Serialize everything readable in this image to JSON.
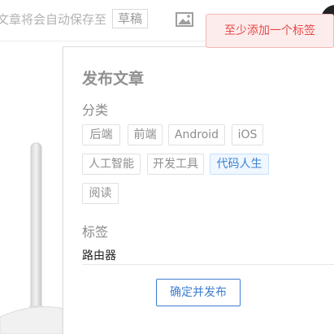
{
  "header": {
    "autosave_text": "文章将会自动保存至",
    "draft_label": "草稿"
  },
  "toast": {
    "message": "至少添加一个标签"
  },
  "publish_panel": {
    "title": "发布文章",
    "category_label": "分类",
    "categories": [
      {
        "label": "后端",
        "selected": false
      },
      {
        "label": "前端",
        "selected": false
      },
      {
        "label": "Android",
        "selected": false
      },
      {
        "label": "iOS",
        "selected": false
      },
      {
        "label": "人工智能",
        "selected": false
      },
      {
        "label": "开发工具",
        "selected": false
      },
      {
        "label": "代码人生",
        "selected": true
      },
      {
        "label": "阅读",
        "selected": false
      }
    ],
    "tags_label": "标签",
    "tag_value": "路由器",
    "publish_button": "确定并发布"
  },
  "colors": {
    "accent": "#3e7ed0",
    "error": "#e64a4a",
    "error_bg": "#fdecec"
  },
  "icons": {
    "image": "image-icon"
  }
}
